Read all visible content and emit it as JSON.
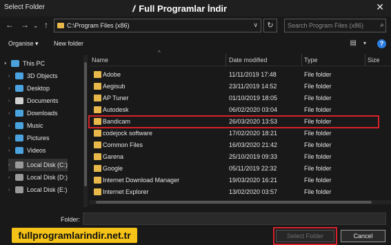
{
  "window": {
    "title": "Select Folder",
    "close_glyph": "✕"
  },
  "watermark": {
    "slash": "//",
    "text": "Full Programlar İndir"
  },
  "nav": {
    "back": "←",
    "forward": "→",
    "dropdown": "⌄",
    "up": "↑",
    "address": "C:\\Program Files (x86)",
    "address_dd": "∨",
    "refresh": "↻",
    "search_placeholder": "Search Program Files (x86)",
    "search_icon": "⌕"
  },
  "toolbar": {
    "organise": "Organise ▾",
    "new_folder": "New folder",
    "view_icon": "▤",
    "view_dd": "▾",
    "help": "?"
  },
  "sidebar": {
    "items": [
      {
        "label": "This PC",
        "chev": "▾",
        "icon": "pc-icon",
        "color": "#4aa3df"
      },
      {
        "label": "3D Objects",
        "chev": "›",
        "icon": "3d-objects-icon",
        "color": "#4aa3df"
      },
      {
        "label": "Desktop",
        "chev": "›",
        "icon": "desktop-icon",
        "color": "#4aa3df"
      },
      {
        "label": "Documents",
        "chev": "›",
        "icon": "documents-icon",
        "color": "#d0d0d0"
      },
      {
        "label": "Downloads",
        "chev": "›",
        "icon": "downloads-icon",
        "color": "#4aa3df"
      },
      {
        "label": "Music",
        "chev": "›",
        "icon": "music-icon",
        "color": "#4aa3df"
      },
      {
        "label": "Pictures",
        "chev": "›",
        "icon": "pictures-icon",
        "color": "#4aa3df"
      },
      {
        "label": "Videos",
        "chev": "›",
        "icon": "videos-icon",
        "color": "#4aa3df"
      },
      {
        "label": "Local Disk (C:)",
        "chev": "›",
        "icon": "disk-icon",
        "color": "#9a9a9a"
      },
      {
        "label": "Local Disk (D:)",
        "chev": "›",
        "icon": "disk-icon",
        "color": "#9a9a9a"
      },
      {
        "label": "Local Disk (E:)",
        "chev": "›",
        "icon": "disk-icon",
        "color": "#9a9a9a"
      }
    ]
  },
  "columns": {
    "name": "Name",
    "date": "Date modified",
    "type": "Type",
    "size": "Size",
    "sort_glyph": "^"
  },
  "rows": [
    {
      "name": "Adobe",
      "date": "11/11/2019 17:48",
      "type": "File folder"
    },
    {
      "name": "Aegisub",
      "date": "23/11/2019 14:52",
      "type": "File folder"
    },
    {
      "name": "AP Tuner",
      "date": "01/10/2019 18:05",
      "type": "File folder"
    },
    {
      "name": "Autodesk",
      "date": "06/02/2020 03:04",
      "type": "File folder"
    },
    {
      "name": "Bandicam",
      "date": "26/03/2020 13:53",
      "type": "File folder"
    },
    {
      "name": "codejock software",
      "date": "17/02/2020 18:21",
      "type": "File folder"
    },
    {
      "name": "Common Files",
      "date": "16/03/2020 21:42",
      "type": "File folder"
    },
    {
      "name": "Garena",
      "date": "25/10/2019 09:33",
      "type": "File folder"
    },
    {
      "name": "Google",
      "date": "05/11/2019 22:32",
      "type": "File folder"
    },
    {
      "name": "Internet Download Manager",
      "date": "19/03/2020 16:21",
      "type": "File folder"
    },
    {
      "name": "Internet Explorer",
      "date": "13/02/2020 03:57",
      "type": "File folder"
    }
  ],
  "footer": {
    "folder_label": "Folder:",
    "folder_value": "",
    "select_button": "Select Folder",
    "cancel_button": "Cancel"
  },
  "badge": {
    "text": "fullprogramlarindir.net.tr"
  },
  "colors": {
    "folder": "#e8b84a",
    "highlight": "#d8222b",
    "badge": "#f5c217",
    "help": "#2b7de0"
  }
}
